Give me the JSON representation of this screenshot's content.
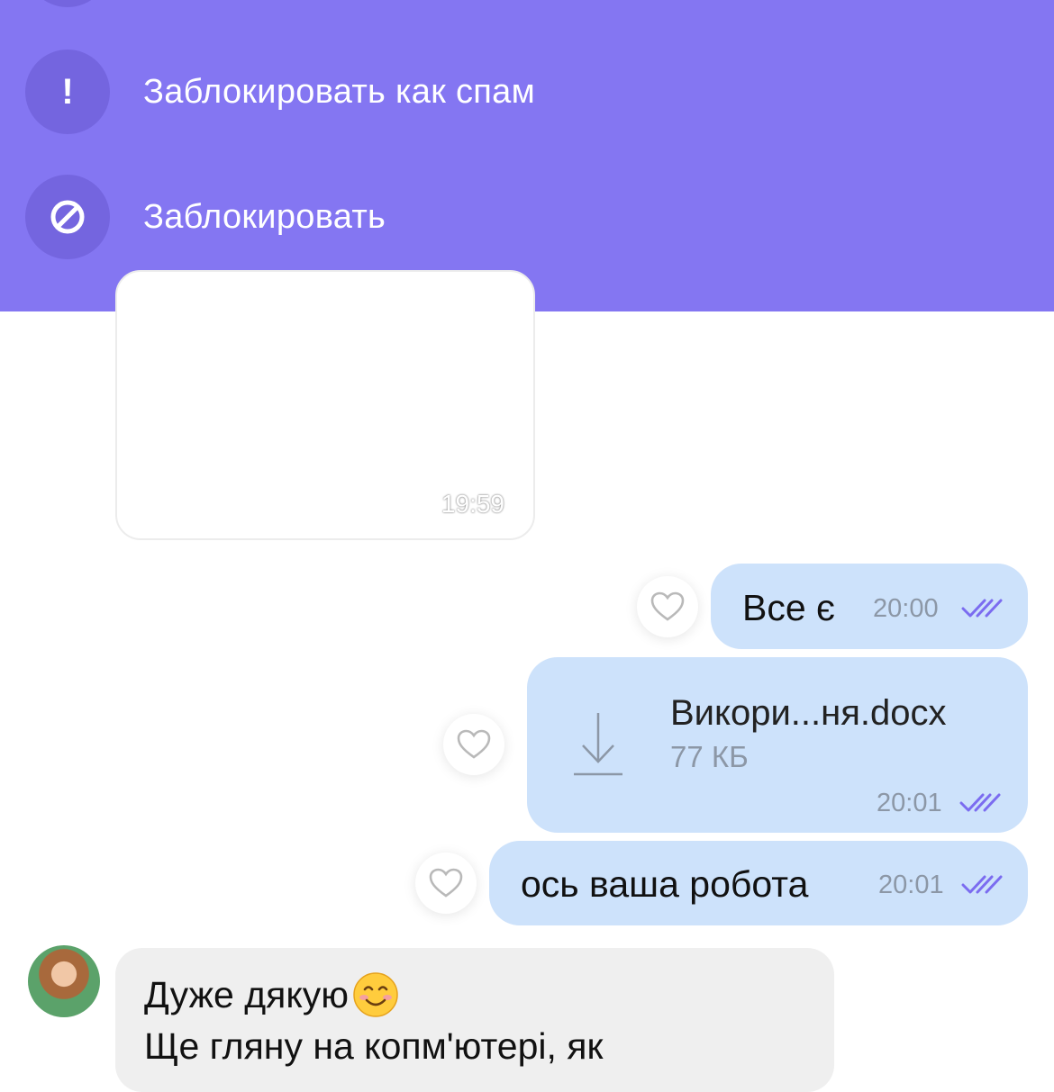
{
  "actions": {
    "block_spam_label": "Заблокировать как спам",
    "block_label": "Заблокировать"
  },
  "messages": {
    "media_time": "19:59",
    "out1_text": "Все є",
    "out1_time": "20:00",
    "file_name": "Викори...ня.docx",
    "file_size": "77 КБ",
    "file_time": "20:01",
    "out3_text": "ось ваша робота",
    "out3_time": "20:01",
    "incoming_line1": "Дуже дякую",
    "incoming_line2": "Ще гляну на копм'ютері, як"
  },
  "colors": {
    "panel_bg": "#8476f2",
    "icon_circle": "#7465df",
    "outgoing_bubble": "#cde2fb",
    "incoming_bubble": "#efefef",
    "read_ticks": "#7b6cf0"
  },
  "icons": {
    "spam": "exclamation-icon",
    "block": "block-icon",
    "like": "heart-icon",
    "download": "download-icon",
    "read": "double-check-icon",
    "emoji": "smiling-face-emoji"
  }
}
